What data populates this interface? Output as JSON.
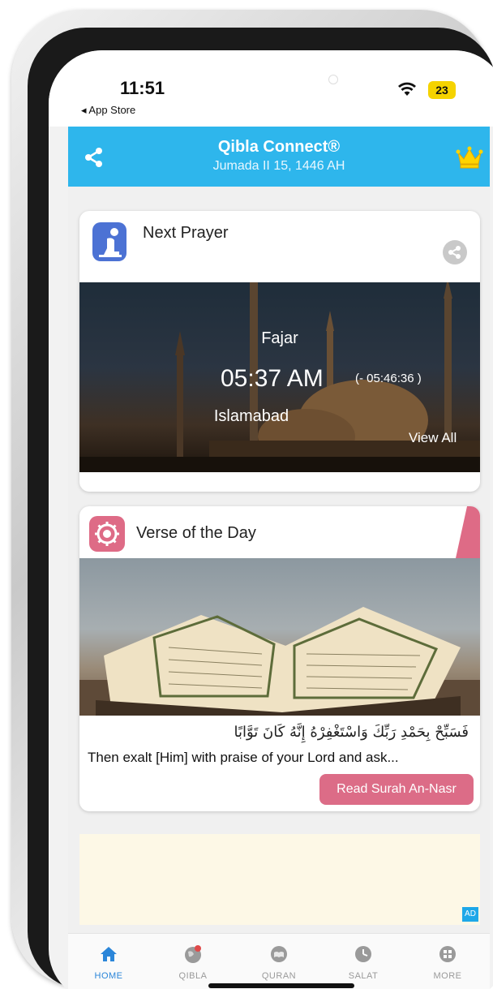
{
  "status_bar": {
    "time": "11:51",
    "back_label": "◂ App Store",
    "battery": "23"
  },
  "header": {
    "title": "Qibla Connect®",
    "subtitle": "Jumada II 15, 1446 AH"
  },
  "next_prayer": {
    "title": "Next Prayer",
    "prayer_name": "Fajar",
    "prayer_time": "05:37 AM",
    "countdown": "(- 05:46:36 )",
    "city": "Islamabad",
    "view_all": "View All"
  },
  "verse": {
    "title": "Verse of the Day",
    "arabic": "فَسَبِّحْ بِحَمْدِ رَبِّكَ وَاسْتَغْفِرْهُ إِنَّهُ كَانَ تَوَّابًا",
    "english": "Then exalt [Him] with praise of your Lord and ask...",
    "read_button": "Read Surah An-Nasr"
  },
  "ad": {
    "badge": "AD"
  },
  "tabs": [
    {
      "label": "HOME",
      "icon": "home-icon",
      "active": true
    },
    {
      "label": "QIBLA",
      "icon": "qibla-globe-icon",
      "active": false
    },
    {
      "label": "QURAN",
      "icon": "quran-icon",
      "active": false
    },
    {
      "label": "SALAT",
      "icon": "clock-icon",
      "active": false
    },
    {
      "label": "MORE",
      "icon": "more-grid-icon",
      "active": false
    }
  ],
  "colors": {
    "header": "#2eb6ec",
    "accent_pink": "#dc6c87",
    "prayer_icon": "#4c72d4",
    "active_tab": "#2b86d9"
  }
}
